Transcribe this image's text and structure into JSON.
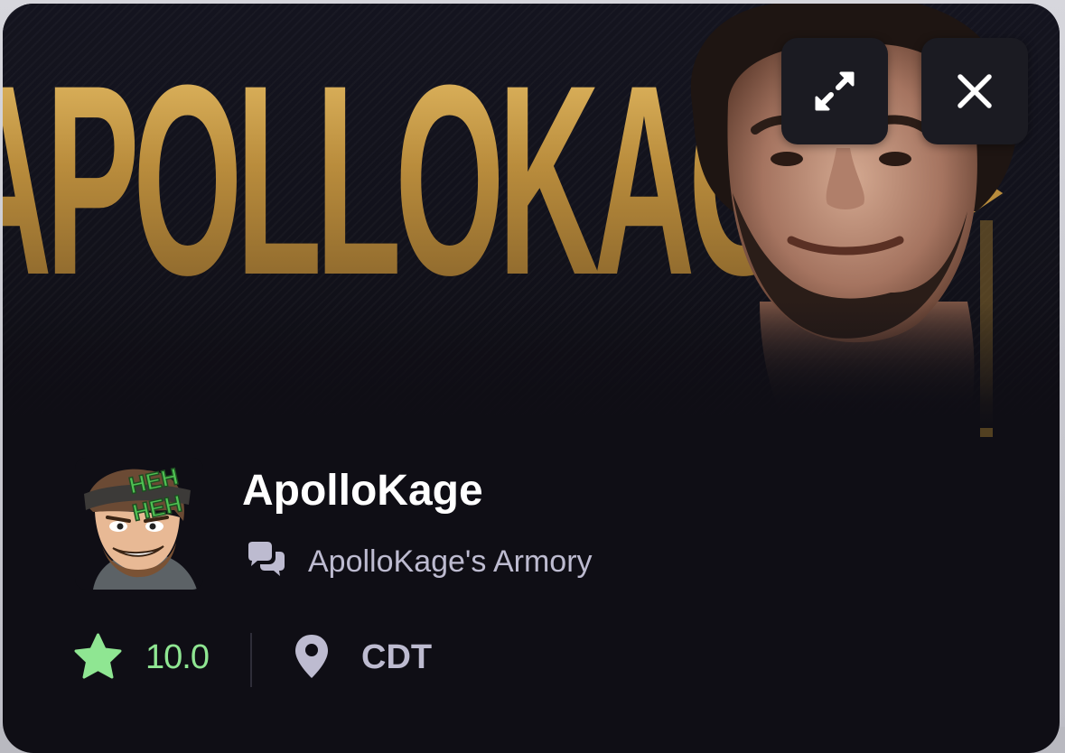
{
  "banner": {
    "title_text": "APOLLOKAGE",
    "expand_label": "Expand",
    "close_label": "Close"
  },
  "profile": {
    "name": "ApolloKage",
    "avatar_text_line1": "HEH",
    "avatar_text_line2": "HEH",
    "community": "ApolloKage's Armory",
    "rating": "10.0",
    "timezone": "CDT"
  },
  "colors": {
    "card_bg": "#0f0e15",
    "gold": "#c89a47",
    "rating_green": "#8fe692",
    "muted_text": "#bdbbd0",
    "button_bg": "#1b1b22"
  },
  "icons": {
    "expand": "expand-arrows-icon",
    "close": "close-icon",
    "community": "chat-bubbles-icon",
    "rating": "star-icon",
    "location": "map-pin-icon"
  }
}
